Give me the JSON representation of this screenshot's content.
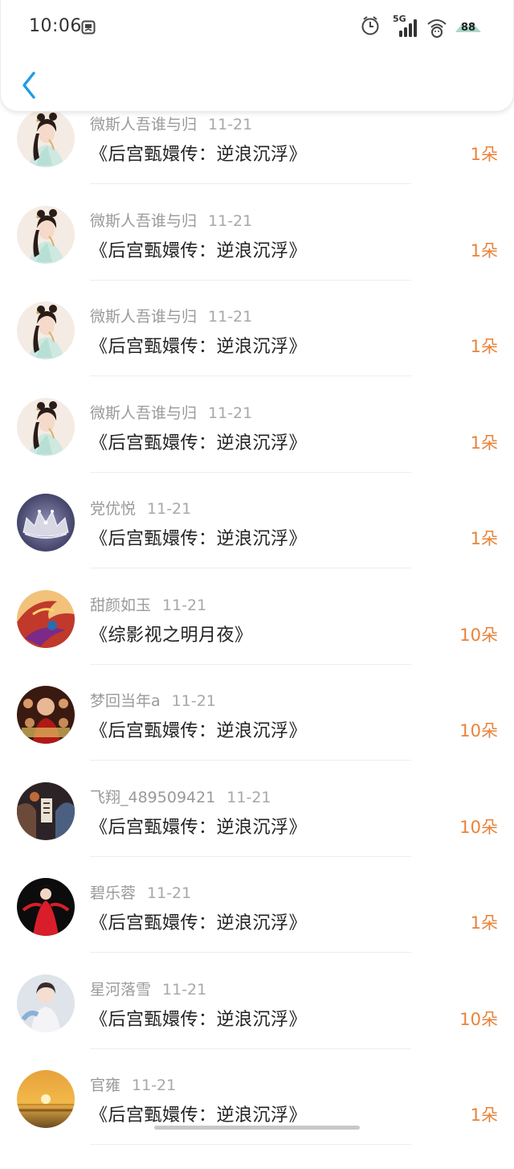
{
  "status_bar": {
    "time": "10:06",
    "network": "5G",
    "battery": "88"
  },
  "header": {
    "back_icon": "chevron-left-icon"
  },
  "rows": [
    {
      "user": "微斯人吾谁与归",
      "date": "11-21",
      "book": "《后宫甄嬛传：逆浪沉浮》",
      "count": "1朵",
      "avatar": "costume-woman"
    },
    {
      "user": "微斯人吾谁与归",
      "date": "11-21",
      "book": "《后宫甄嬛传：逆浪沉浮》",
      "count": "1朵",
      "avatar": "costume-woman"
    },
    {
      "user": "微斯人吾谁与归",
      "date": "11-21",
      "book": "《后宫甄嬛传：逆浪沉浮》",
      "count": "1朵",
      "avatar": "costume-woman"
    },
    {
      "user": "微斯人吾谁与归",
      "date": "11-21",
      "book": "《后宫甄嬛传：逆浪沉浮》",
      "count": "1朵",
      "avatar": "costume-woman"
    },
    {
      "user": "党优悦",
      "date": "11-21",
      "book": "《后宫甄嬛传：逆浪沉浮》",
      "count": "1朵",
      "avatar": "crown"
    },
    {
      "user": "甜颜如玉",
      "date": "11-21",
      "book": "《综影视之明月夜》",
      "count": "10朵",
      "avatar": "phoenix"
    },
    {
      "user": "梦回当年a",
      "date": "11-21",
      "book": "《后宫甄嬛传：逆浪沉浮》",
      "count": "10朵",
      "avatar": "movie-poster"
    },
    {
      "user": "飞翔_489509421",
      "date": "11-21",
      "book": "《后宫甄嬛传：逆浪沉浮》",
      "count": "10朵",
      "avatar": "dark-poster"
    },
    {
      "user": "碧乐蓉",
      "date": "11-21",
      "book": "《后宫甄嬛传：逆浪沉浮》",
      "count": "1朵",
      "avatar": "red-dress"
    },
    {
      "user": "星河落雪",
      "date": "11-21",
      "book": "《后宫甄嬛传：逆浪沉浮》",
      "count": "10朵",
      "avatar": "girl-portrait"
    },
    {
      "user": "官雍",
      "date": "11-21",
      "book": "《后宫甄嬛传：逆浪沉浮》",
      "count": "1朵",
      "avatar": "sunset"
    }
  ],
  "colors": {
    "accent_count": "#e8833a",
    "back_arrow": "#1e9be8"
  }
}
